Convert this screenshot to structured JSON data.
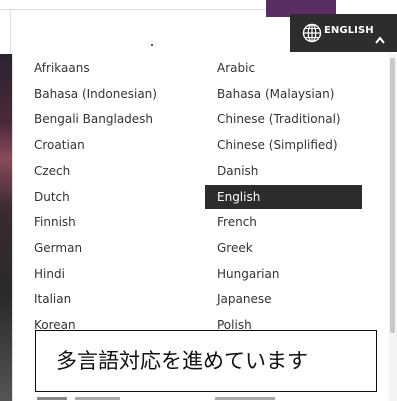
{
  "header": {
    "language_button_label": "ENGLISH",
    "globe_icon": "globe-icon",
    "chevron_icon": "chevron-up-icon",
    "button_color": "#2d2d2d",
    "accent_color": "#5a2d63"
  },
  "language_menu": {
    "selected": "English",
    "selected_color": "#2d2d2d",
    "left_column": [
      "Afrikaans",
      "Bahasa (Indonesian)",
      "Bengali Bangladesh",
      "Croatian",
      "Czech",
      "Dutch",
      "Finnish",
      "German",
      "Hindi",
      "Italian",
      "Korean"
    ],
    "right_column": [
      "Arabic",
      "Bahasa (Malaysian)",
      "Chinese (Traditional)",
      "Chinese (Simplified)",
      "Danish",
      "English",
      "French",
      "Greek",
      "Hungarian",
      "Japanese",
      "Polish"
    ]
  },
  "callout": {
    "text": "多言語対応を進めています"
  }
}
